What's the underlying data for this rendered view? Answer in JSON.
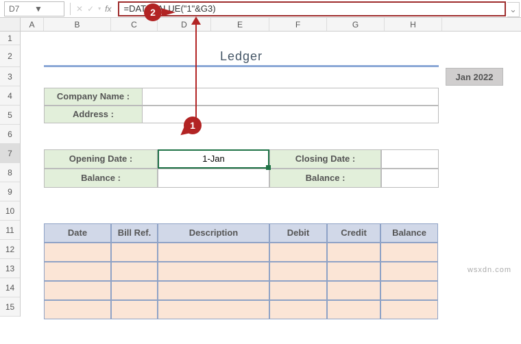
{
  "namebox": {
    "cell_ref": "D7"
  },
  "formula_bar": {
    "value": "=DATEVALUE(\"1\"&G3)"
  },
  "columns": [
    "A",
    "B",
    "C",
    "D",
    "E",
    "F",
    "G",
    "H"
  ],
  "rows": [
    "1",
    "2",
    "3",
    "4",
    "5",
    "6",
    "7",
    "8",
    "9",
    "10",
    "11",
    "12",
    "13",
    "14",
    "15"
  ],
  "ledger": {
    "title": "Ledger",
    "month_cell": "Jan 2022",
    "company_label": "Company Name :",
    "address_label": "Address :",
    "opening_date_label": "Opening Date :",
    "opening_date_value": "1-Jan",
    "closing_date_label": "Closing Date :",
    "balance_label_left": "Balance :",
    "balance_label_right": "Balance :"
  },
  "table_headers": {
    "date": "Date",
    "bill": "Bill Ref.",
    "desc": "Description",
    "debit": "Debit",
    "credit": "Credit",
    "balance": "Balance"
  },
  "callouts": {
    "one": "1",
    "two": "2"
  },
  "watermark": "wsxdn.com"
}
